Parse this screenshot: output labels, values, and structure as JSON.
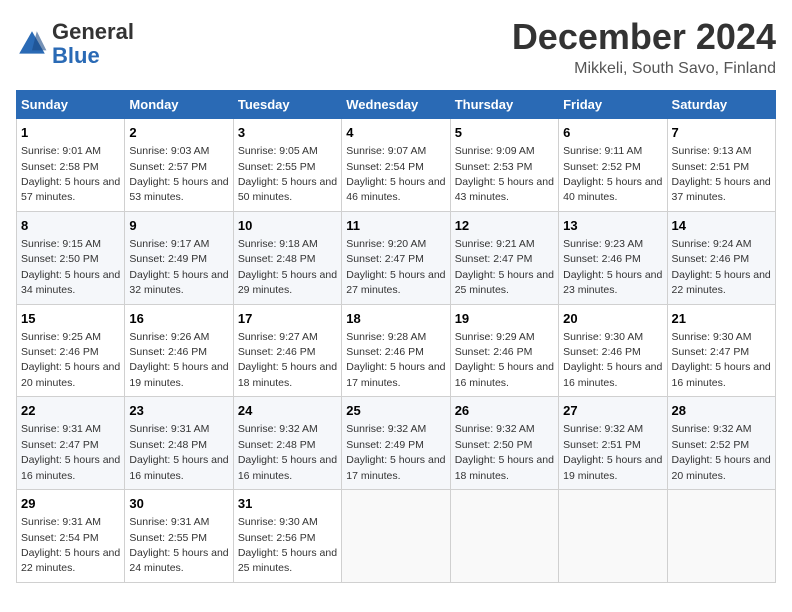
{
  "header": {
    "logo_line1": "General",
    "logo_line2": "Blue",
    "title": "December 2024",
    "subtitle": "Mikkeli, South Savo, Finland"
  },
  "days_of_week": [
    "Sunday",
    "Monday",
    "Tuesday",
    "Wednesday",
    "Thursday",
    "Friday",
    "Saturday"
  ],
  "weeks": [
    [
      {
        "num": "1",
        "sunrise": "9:01 AM",
        "sunset": "2:58 PM",
        "daylight": "5 hours and 57 minutes."
      },
      {
        "num": "2",
        "sunrise": "9:03 AM",
        "sunset": "2:57 PM",
        "daylight": "5 hours and 53 minutes."
      },
      {
        "num": "3",
        "sunrise": "9:05 AM",
        "sunset": "2:55 PM",
        "daylight": "5 hours and 50 minutes."
      },
      {
        "num": "4",
        "sunrise": "9:07 AM",
        "sunset": "2:54 PM",
        "daylight": "5 hours and 46 minutes."
      },
      {
        "num": "5",
        "sunrise": "9:09 AM",
        "sunset": "2:53 PM",
        "daylight": "5 hours and 43 minutes."
      },
      {
        "num": "6",
        "sunrise": "9:11 AM",
        "sunset": "2:52 PM",
        "daylight": "5 hours and 40 minutes."
      },
      {
        "num": "7",
        "sunrise": "9:13 AM",
        "sunset": "2:51 PM",
        "daylight": "5 hours and 37 minutes."
      }
    ],
    [
      {
        "num": "8",
        "sunrise": "9:15 AM",
        "sunset": "2:50 PM",
        "daylight": "5 hours and 34 minutes."
      },
      {
        "num": "9",
        "sunrise": "9:17 AM",
        "sunset": "2:49 PM",
        "daylight": "5 hours and 32 minutes."
      },
      {
        "num": "10",
        "sunrise": "9:18 AM",
        "sunset": "2:48 PM",
        "daylight": "5 hours and 29 minutes."
      },
      {
        "num": "11",
        "sunrise": "9:20 AM",
        "sunset": "2:47 PM",
        "daylight": "5 hours and 27 minutes."
      },
      {
        "num": "12",
        "sunrise": "9:21 AM",
        "sunset": "2:47 PM",
        "daylight": "5 hours and 25 minutes."
      },
      {
        "num": "13",
        "sunrise": "9:23 AM",
        "sunset": "2:46 PM",
        "daylight": "5 hours and 23 minutes."
      },
      {
        "num": "14",
        "sunrise": "9:24 AM",
        "sunset": "2:46 PM",
        "daylight": "5 hours and 22 minutes."
      }
    ],
    [
      {
        "num": "15",
        "sunrise": "9:25 AM",
        "sunset": "2:46 PM",
        "daylight": "5 hours and 20 minutes."
      },
      {
        "num": "16",
        "sunrise": "9:26 AM",
        "sunset": "2:46 PM",
        "daylight": "5 hours and 19 minutes."
      },
      {
        "num": "17",
        "sunrise": "9:27 AM",
        "sunset": "2:46 PM",
        "daylight": "5 hours and 18 minutes."
      },
      {
        "num": "18",
        "sunrise": "9:28 AM",
        "sunset": "2:46 PM",
        "daylight": "5 hours and 17 minutes."
      },
      {
        "num": "19",
        "sunrise": "9:29 AM",
        "sunset": "2:46 PM",
        "daylight": "5 hours and 16 minutes."
      },
      {
        "num": "20",
        "sunrise": "9:30 AM",
        "sunset": "2:46 PM",
        "daylight": "5 hours and 16 minutes."
      },
      {
        "num": "21",
        "sunrise": "9:30 AM",
        "sunset": "2:47 PM",
        "daylight": "5 hours and 16 minutes."
      }
    ],
    [
      {
        "num": "22",
        "sunrise": "9:31 AM",
        "sunset": "2:47 PM",
        "daylight": "5 hours and 16 minutes."
      },
      {
        "num": "23",
        "sunrise": "9:31 AM",
        "sunset": "2:48 PM",
        "daylight": "5 hours and 16 minutes."
      },
      {
        "num": "24",
        "sunrise": "9:32 AM",
        "sunset": "2:48 PM",
        "daylight": "5 hours and 16 minutes."
      },
      {
        "num": "25",
        "sunrise": "9:32 AM",
        "sunset": "2:49 PM",
        "daylight": "5 hours and 17 minutes."
      },
      {
        "num": "26",
        "sunrise": "9:32 AM",
        "sunset": "2:50 PM",
        "daylight": "5 hours and 18 minutes."
      },
      {
        "num": "27",
        "sunrise": "9:32 AM",
        "sunset": "2:51 PM",
        "daylight": "5 hours and 19 minutes."
      },
      {
        "num": "28",
        "sunrise": "9:32 AM",
        "sunset": "2:52 PM",
        "daylight": "5 hours and 20 minutes."
      }
    ],
    [
      {
        "num": "29",
        "sunrise": "9:31 AM",
        "sunset": "2:54 PM",
        "daylight": "5 hours and 22 minutes."
      },
      {
        "num": "30",
        "sunrise": "9:31 AM",
        "sunset": "2:55 PM",
        "daylight": "5 hours and 24 minutes."
      },
      {
        "num": "31",
        "sunrise": "9:30 AM",
        "sunset": "2:56 PM",
        "daylight": "5 hours and 25 minutes."
      },
      null,
      null,
      null,
      null
    ]
  ],
  "labels": {
    "sunrise": "Sunrise:",
    "sunset": "Sunset:",
    "daylight": "Daylight:"
  }
}
